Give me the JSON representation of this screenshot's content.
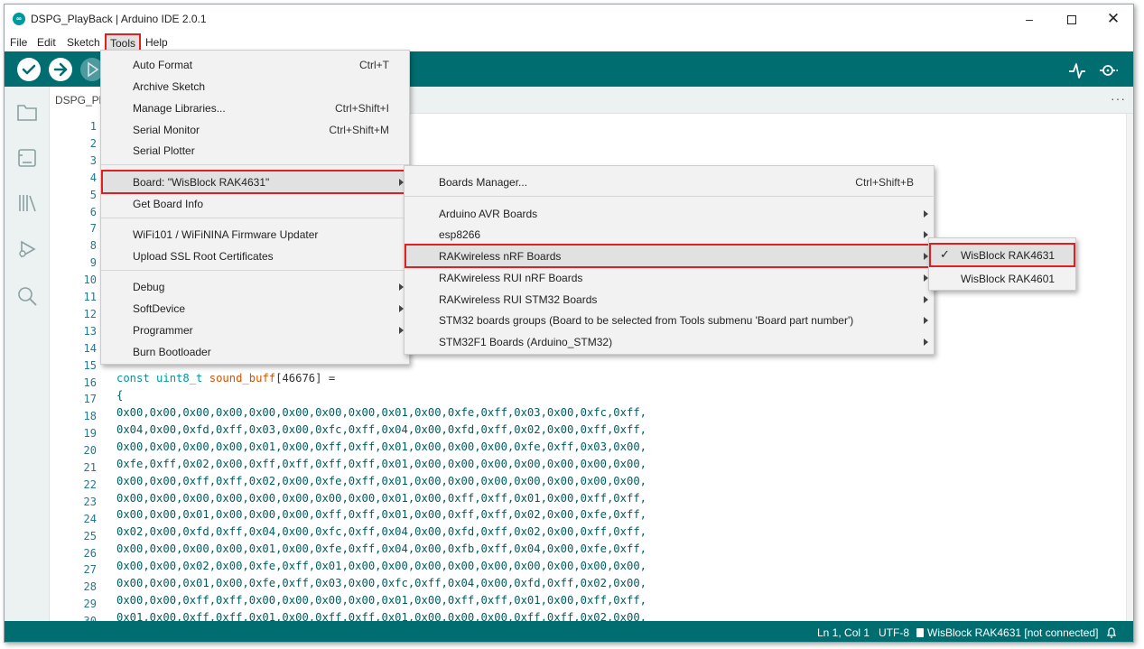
{
  "window": {
    "title": "DSPG_PlayBack | Arduino IDE 2.0.1",
    "logo_text": "∞",
    "min": "–",
    "close": "✕"
  },
  "menubar": {
    "file": "File",
    "edit": "Edit",
    "sketch": "Sketch",
    "tools": "Tools",
    "help": "Help"
  },
  "tab": {
    "label": "DSPG_PlayBack",
    "more": "···"
  },
  "tools_menu": {
    "auto_format": "Auto Format",
    "auto_format_sc": "Ctrl+T",
    "archive": "Archive Sketch",
    "manage_libs": "Manage Libraries...",
    "manage_libs_sc": "Ctrl+Shift+I",
    "serial_monitor": "Serial Monitor",
    "serial_monitor_sc": "Ctrl+Shift+M",
    "serial_plotter": "Serial Plotter",
    "board": "Board: \"WisBlock RAK4631\"",
    "board_info": "Get Board Info",
    "wifi_updater": "WiFi101 / WiFiNINA Firmware Updater",
    "ssl_upload": "Upload SSL Root Certificates",
    "debug": "Debug",
    "softdevice": "SoftDevice",
    "programmer": "Programmer",
    "burn_bootloader": "Burn Bootloader"
  },
  "boards_menu": {
    "manager": "Boards Manager...",
    "manager_sc": "Ctrl+Shift+B",
    "avr": "Arduino AVR Boards",
    "esp": "esp8266",
    "rak_nrf": "RAKwireless nRF Boards",
    "rak_rui_nrf": "RAKwireless RUI nRF Boards",
    "rak_rui_stm": "RAKwireless RUI STM32 Boards",
    "stm_groups": "STM32 boards groups (Board to be selected from Tools submenu 'Board part number')",
    "stm_f1": "STM32F1 Boards (Arduino_STM32)"
  },
  "rak_menu": {
    "check": "✓",
    "rak4631": "WisBlock RAK4631",
    "rak4601": "WisBlock RAK4601"
  },
  "editor": {
    "line_numbers": [
      "1",
      "2",
      "3",
      "4",
      "5",
      "6",
      "7",
      "8",
      "9",
      "10",
      "11",
      "12",
      "13",
      "14",
      "15",
      "16",
      "17",
      "18",
      "19",
      "20",
      "21",
      "22",
      "23",
      "24",
      "25",
      "26",
      "27",
      "28",
      "29",
      "30"
    ],
    "line16_kw": "const",
    "line16_type": "uint8_t",
    "line16_name": "sound_buff",
    "line16_rest": "[46676] =",
    "line17": "{",
    "hex_lines": [
      "0x00,0x00,0x00,0x00,0x00,0x00,0x00,0x00,0x01,0x00,0xfe,0xff,0x03,0x00,0xfc,0xff,",
      "0x04,0x00,0xfd,0xff,0x03,0x00,0xfc,0xff,0x04,0x00,0xfd,0xff,0x02,0x00,0xff,0xff,",
      "0x00,0x00,0x00,0x00,0x01,0x00,0xff,0xff,0x01,0x00,0x00,0x00,0xfe,0xff,0x03,0x00,",
      "0xfe,0xff,0x02,0x00,0xff,0xff,0xff,0xff,0x01,0x00,0x00,0x00,0x00,0x00,0x00,0x00,",
      "0x00,0x00,0xff,0xff,0x02,0x00,0xfe,0xff,0x01,0x00,0x00,0x00,0x00,0x00,0x00,0x00,",
      "0x00,0x00,0x00,0x00,0x00,0x00,0x00,0x00,0x01,0x00,0xff,0xff,0x01,0x00,0xff,0xff,",
      "0x00,0x00,0x01,0x00,0x00,0x00,0xff,0xff,0x01,0x00,0xff,0xff,0x02,0x00,0xfe,0xff,",
      "0x02,0x00,0xfd,0xff,0x04,0x00,0xfc,0xff,0x04,0x00,0xfd,0xff,0x02,0x00,0xff,0xff,",
      "0x00,0x00,0x00,0x00,0x01,0x00,0xfe,0xff,0x04,0x00,0xfb,0xff,0x04,0x00,0xfe,0xff,",
      "0x00,0x00,0x02,0x00,0xfe,0xff,0x01,0x00,0x00,0x00,0x00,0x00,0x00,0x00,0x00,0x00,",
      "0x00,0x00,0x01,0x00,0xfe,0xff,0x03,0x00,0xfc,0xff,0x04,0x00,0xfd,0xff,0x02,0x00,",
      "0x00,0x00,0xff,0xff,0x00,0x00,0x00,0x00,0x01,0x00,0xff,0xff,0x01,0x00,0xff,0xff,",
      "0x01,0x00,0xff,0xff,0x01,0x00,0xff,0xff,0x01,0x00,0x00,0x00,0xff,0xff,0x02,0x00,"
    ]
  },
  "status": {
    "position": "Ln 1, Col 1",
    "encoding": "UTF-8",
    "board": "WisBlock RAK4631 [not connected]"
  },
  "colors": {
    "teal": "#006d70",
    "accent": "#00979d",
    "highlight_border": "#e02020"
  }
}
